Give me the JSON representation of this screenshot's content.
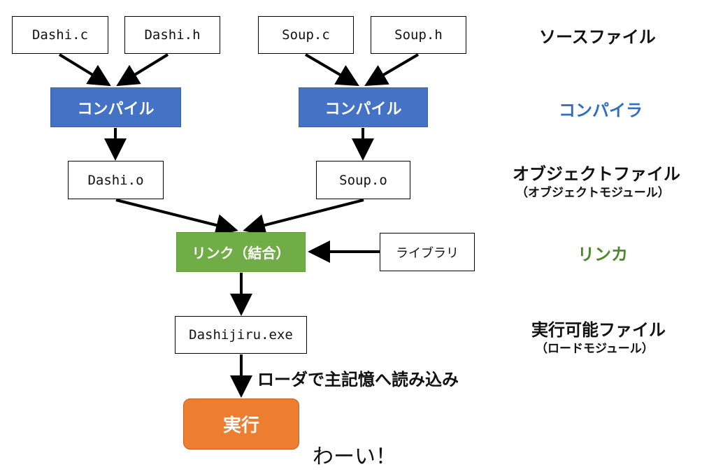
{
  "files": {
    "dashi_c": "Dashi.c",
    "dashi_h": "Dashi.h",
    "soup_c": "Soup.c",
    "soup_h": "Soup.h",
    "dashi_o": "Dashi.o",
    "soup_o": "Soup.o",
    "exe": "Dashijiru.exe",
    "library": "ライブラリ"
  },
  "process": {
    "compile_left": "コンパイル",
    "compile_right": "コンパイル",
    "link": "リンク（結合）",
    "run": "実行"
  },
  "labels": {
    "source": "ソースファイル",
    "compiler": "コンパイラ",
    "object": "オブジェクトファイル",
    "object_sub": "（オブジェクトモジュール）",
    "linker": "リンカ",
    "executable": "実行可能ファイル",
    "executable_sub": "（ロードモジュール）",
    "loader": "ローダで主記憶へ読み込み",
    "yay": "わーい！"
  },
  "colors": {
    "compile": "#4472c4",
    "link": "#70ad47",
    "run": "#ed7d31",
    "compiler_label": "#2e6fc4",
    "linker_label": "#4f8a2a"
  }
}
